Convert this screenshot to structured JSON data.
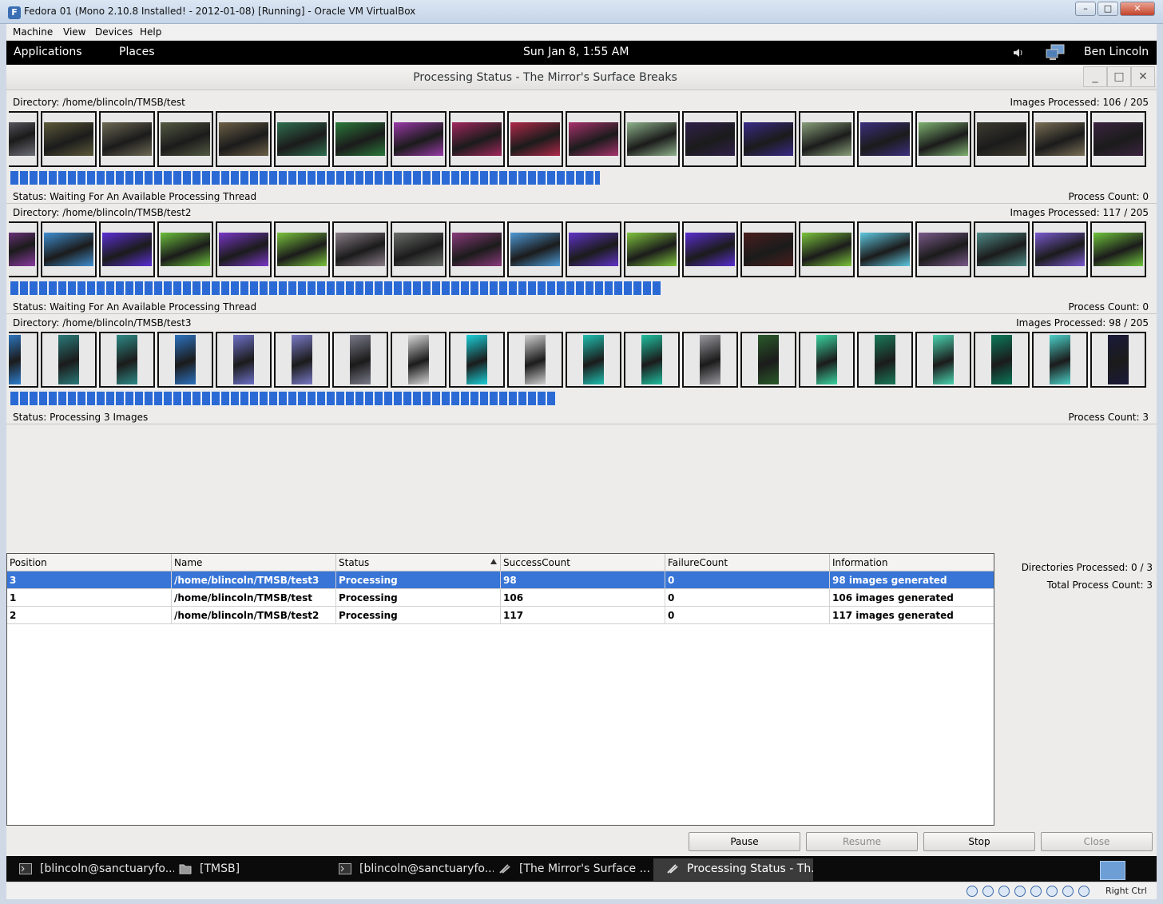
{
  "host_window": {
    "title": "Fedora 01 (Mono 2.10.8 Installed! - 2012-01-08) [Running] - Oracle VM VirtualBox",
    "menu": [
      "Machine",
      "View",
      "Devices",
      "Help"
    ],
    "host_key": "Right Ctrl"
  },
  "gnome_panel": {
    "applications": "Applications",
    "places": "Places",
    "clock": "Sun Jan  8,  1:55 AM",
    "user": "Ben Lincoln"
  },
  "app_window": {
    "title": "Processing Status - The Mirror's Surface Breaks"
  },
  "directories": [
    {
      "directory": "Directory: /home/blincoln/TMSB/test",
      "images_processed": "Images Processed: 106 / 205",
      "progress": 0.517,
      "status": "Status: Waiting For An Available Processing Thread",
      "process_count": "Process Count: 0",
      "thumb_orientation": "landscape",
      "thumb_colors": [
        "#6e6e78",
        "#5d5a39",
        "#6e6a55",
        "#545a42",
        "#6c6047",
        "#2f6f4f",
        "#2b7a3a",
        "#9a3aa8",
        "#a2285e",
        "#b0294a",
        "#a8326e",
        "#8fb28c",
        "#30214a",
        "#3a2a88",
        "#89a07a",
        "#3c2f7e",
        "#7fb271",
        "#3d3b30",
        "#7b7057",
        "#3b2440"
      ]
    },
    {
      "directory": "Directory: /home/blincoln/TMSB/test2",
      "images_processed": "Images Processed: 117 / 205",
      "progress": 0.571,
      "status": "Status: Waiting For An Available Processing Thread",
      "process_count": "Process Count: 0",
      "thumb_orientation": "landscape",
      "thumb_colors": [
        "#8a3aa0",
        "#3f8fd0",
        "#5b2fd6",
        "#6bbf3b",
        "#7a36c8",
        "#7ac43c",
        "#8a7e88",
        "#6a6e6a",
        "#8b3a7c",
        "#4d9ad6",
        "#6033c8",
        "#7fc43c",
        "#5a2ed0",
        "#4a1e1e",
        "#7bc43c",
        "#5fc8e0",
        "#7a5a8a",
        "#4e8c88",
        "#7a5ad0",
        "#6fc43c"
      ]
    },
    {
      "directory": "Directory: /home/blincoln/TMSB/test3",
      "images_processed": "Images Processed: 98 / 205",
      "progress": 0.478,
      "status": "Status: Processing 3 Images",
      "process_count": "Process Count: 3",
      "thumb_orientation": "portrait",
      "thumb_colors": [
        "#2e7fcf",
        "#2a7a7a",
        "#2d8a86",
        "#2c72c0",
        "#6d70c8",
        "#7a7ac8",
        "#7a7a8a",
        "#d8d8d8",
        "#1ad0d8",
        "#d0d0d0",
        "#1fbfb0",
        "#1fbfa0",
        "#9a9aa0",
        "#2a5a2a",
        "#3ad4a0",
        "#1a7a5a",
        "#4ad4b0",
        "#0a7a5a",
        "#4ad0c8",
        "#1a1a3a"
      ]
    }
  ],
  "table": {
    "columns": [
      "Position",
      "Name",
      "Status",
      "SuccessCount",
      "FailureCount",
      "Information"
    ],
    "sorted_column": "Status",
    "rows": [
      {
        "position": "3",
        "name": "/home/blincoln/TMSB/test3",
        "status": "Processing",
        "success": "98",
        "failure": "0",
        "info": "98 images generated",
        "selected": true
      },
      {
        "position": "1",
        "name": "/home/blincoln/TMSB/test",
        "status": "Processing",
        "success": "106",
        "failure": "0",
        "info": "106 images generated",
        "selected": false
      },
      {
        "position": "2",
        "name": "/home/blincoln/TMSB/test2",
        "status": "Processing",
        "success": "117",
        "failure": "0",
        "info": "117 images generated",
        "selected": false
      }
    ]
  },
  "summary": {
    "directories_processed": "Directories Processed: 0 / 3",
    "total_process_count": "Total Process Count: 3"
  },
  "buttons": {
    "pause": "Pause",
    "resume": "Resume",
    "stop": "Stop",
    "close": "Close"
  },
  "taskbar": [
    {
      "label": "[blincoln@sanctuaryfo...",
      "icon": "terminal-icon",
      "active": false
    },
    {
      "label": "[TMSB]",
      "icon": "folder-icon",
      "active": false
    },
    {
      "label": "[blincoln@sanctuaryfo...",
      "icon": "terminal-icon",
      "active": false
    },
    {
      "label": "[The Mirror's Surface ...",
      "icon": "app-icon",
      "active": false
    },
    {
      "label": "Processing Status - Th...",
      "icon": "app-icon",
      "active": true
    }
  ],
  "colors": {
    "progress": "#2b6ad4",
    "selection": "#3875d7",
    "panel": "#000000"
  }
}
